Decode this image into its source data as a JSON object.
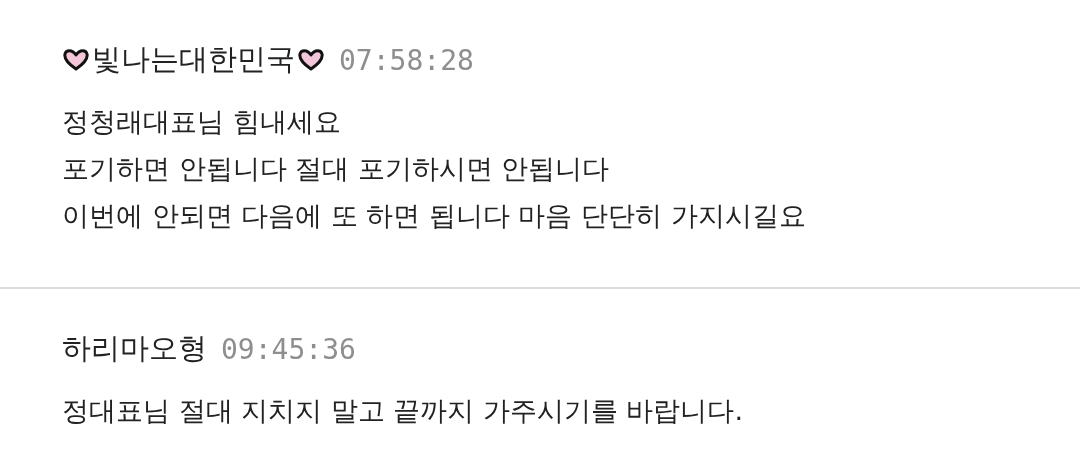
{
  "comments": [
    {
      "author": "빛나는대한민국",
      "hearts": true,
      "time": "07:58:28",
      "lines": [
        "정청래대표님 힘내세요",
        "포기하면 안됩니다 절대 포기하시면 안됩니다",
        "이번에 안되면 다음에 또 하면 됩니다 마음 단단히 가지시길요"
      ]
    },
    {
      "author": "하리마오형",
      "hearts": false,
      "time": "09:45:36",
      "lines": [
        "정대표님 절대 지치지 말고 끝까지 가주시기를 바랍니다."
      ]
    }
  ]
}
